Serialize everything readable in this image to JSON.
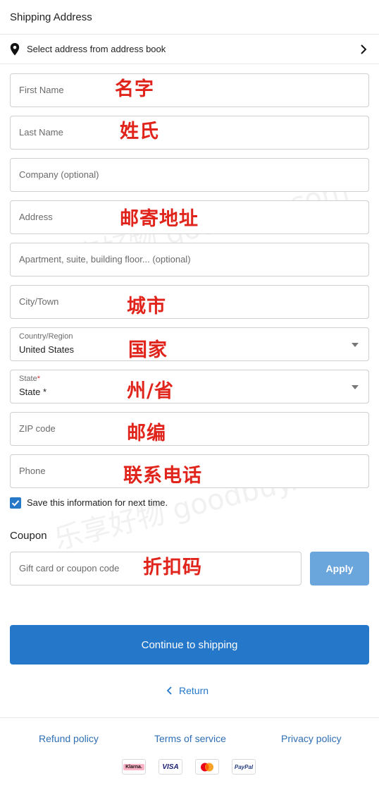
{
  "header": {
    "title": "Shipping Address"
  },
  "address_book": {
    "label": "Select address from address book",
    "icon": "map-pin-icon"
  },
  "form": {
    "first_name": {
      "placeholder": "First Name",
      "annotation": "名字"
    },
    "last_name": {
      "placeholder": "Last Name",
      "annotation": "姓氏"
    },
    "company": {
      "placeholder": "Company (optional)"
    },
    "address": {
      "placeholder": "Address",
      "annotation": "邮寄地址"
    },
    "apartment": {
      "placeholder": "Apartment, suite, building floor... (optional)"
    },
    "city": {
      "placeholder": "City/Town",
      "annotation": "城市"
    },
    "country": {
      "label": "Country/Region",
      "value": "United States",
      "annotation": "国家"
    },
    "state": {
      "label": "State",
      "value": "State",
      "required_mark": "*",
      "annotation": "州/省"
    },
    "zip": {
      "placeholder": "ZIP code",
      "annotation": "邮编"
    },
    "phone": {
      "placeholder": "Phone",
      "annotation": "联系电话"
    }
  },
  "save_info": {
    "label": "Save this information for next time.",
    "checked": true
  },
  "coupon": {
    "title": "Coupon",
    "placeholder": "Gift card or coupon code",
    "annotation": "折扣码",
    "apply_label": "Apply"
  },
  "actions": {
    "continue_label": "Continue to shipping",
    "return_label": "Return"
  },
  "footer": {
    "links": [
      "Refund policy",
      "Terms of service",
      "Privacy policy"
    ],
    "payments": [
      "Klarna.",
      "VISA",
      "mastercard",
      "PayPal"
    ]
  },
  "watermark": "乐享好物 goodbuy.com",
  "colors": {
    "accent": "#2477c9",
    "apply_disabled": "#6aa5dc",
    "annotation": "#e0241b"
  }
}
